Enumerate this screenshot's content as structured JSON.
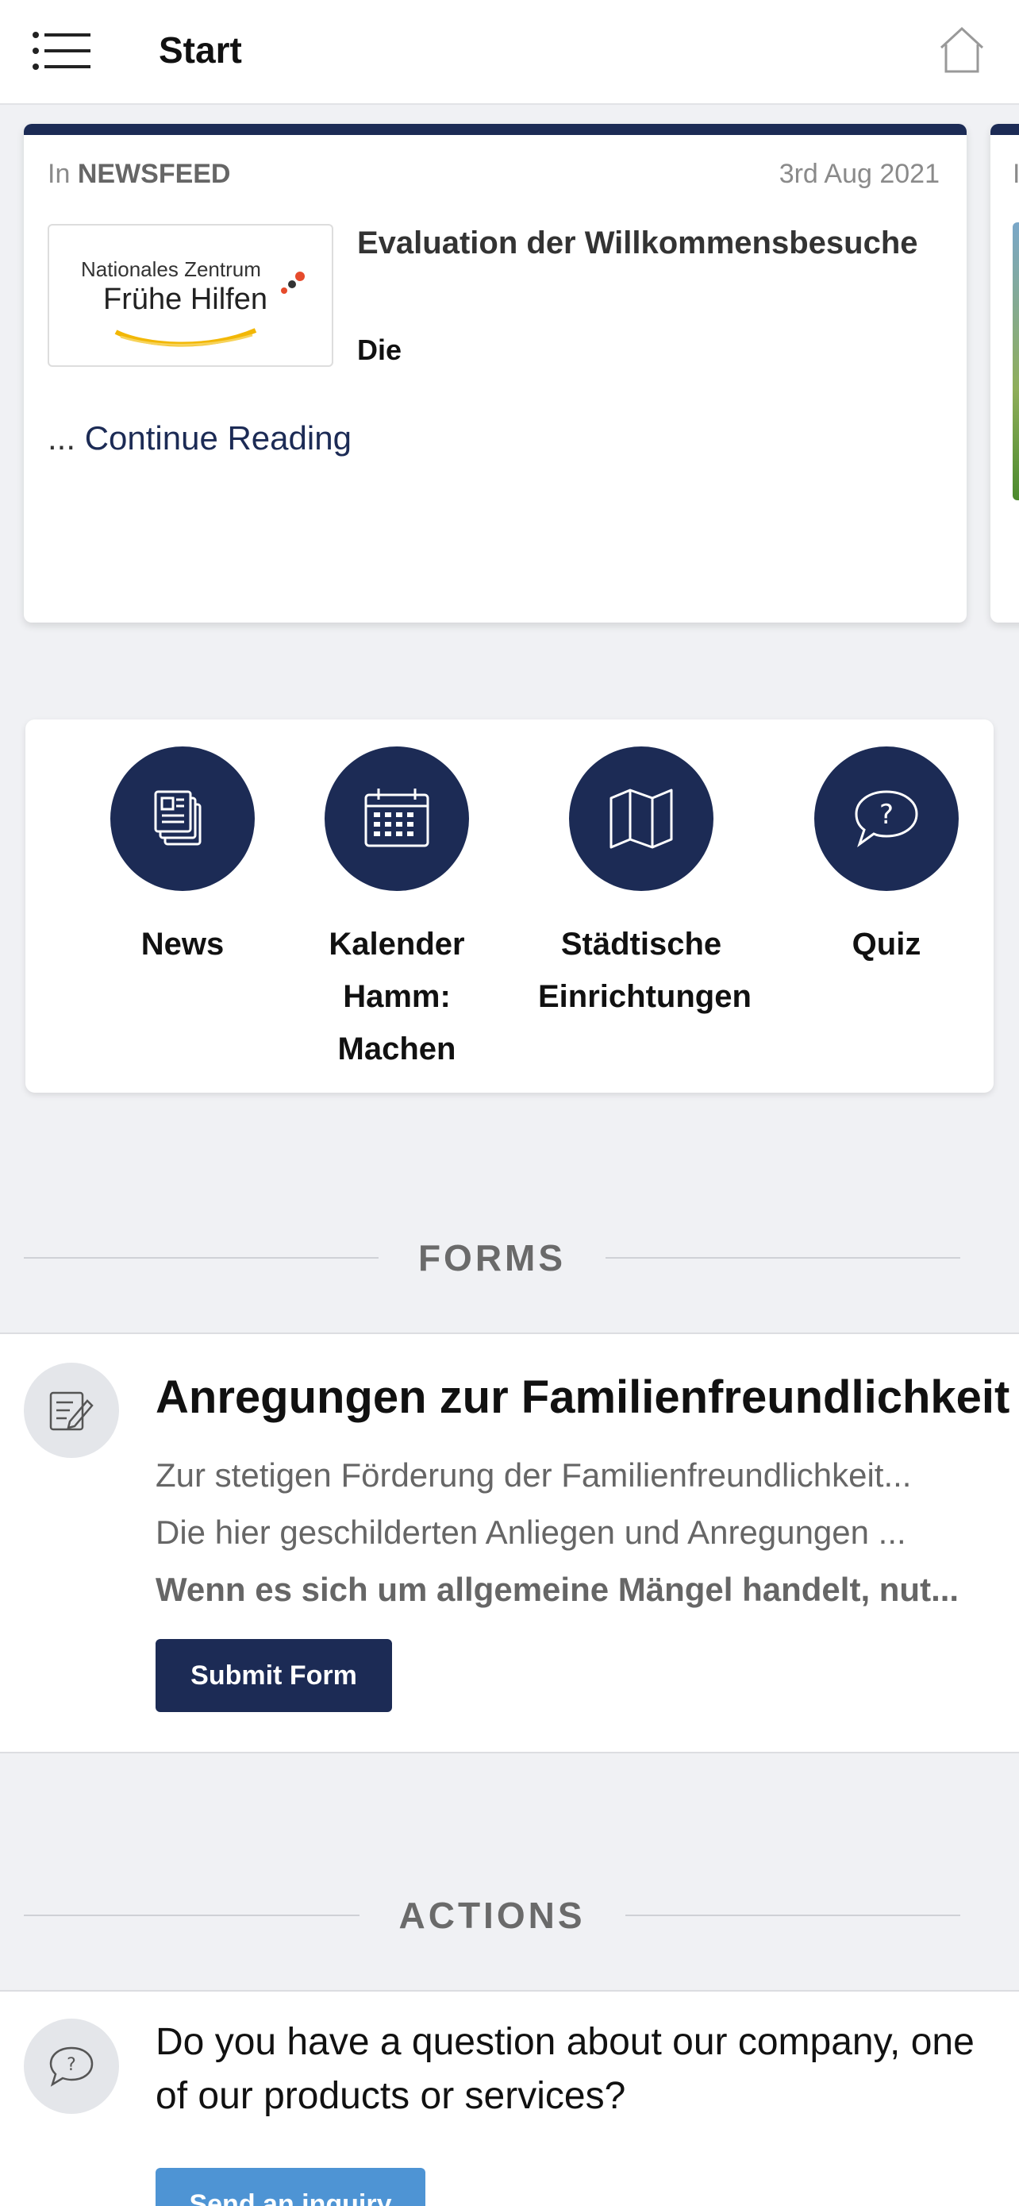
{
  "header": {
    "title": "Start"
  },
  "news_card": {
    "in_prefix": "In",
    "category": "NEWSFEED",
    "date": "3rd Aug 2021",
    "logo_line1": "Nationales Zentrum",
    "logo_line2": "Frühe Hilfen",
    "headline": "Evaluation der Willkommensbesuche",
    "snippet": "Die",
    "continue_dots": "...",
    "continue_label": "Continue Reading"
  },
  "peek_card": {
    "category_initial": "I"
  },
  "shortcuts": [
    {
      "label": "News",
      "icon": "newspaper-icon"
    },
    {
      "label": "Kalender Hamm: Machen",
      "icon": "calendar-icon"
    },
    {
      "label": "Städtische Einrichtungen",
      "icon": "map-icon"
    },
    {
      "label": "Quiz",
      "icon": "question-bubble-icon"
    }
  ],
  "forms": {
    "section_title": "FORMS",
    "item": {
      "icon": "edit-document-icon",
      "title": "Anregungen zur Familienfreundlichkeit",
      "line1": "Zur stetigen Förderung der Familienfreundlichkeit...",
      "line2": "Die hier geschilderten Anliegen und Anregungen ...",
      "line3": "Wenn es sich um allgemeine Mängel handelt, nut...",
      "button": "Submit Form"
    }
  },
  "actions": {
    "section_title": "ACTIONS",
    "item": {
      "icon": "chat-bubble-icon",
      "text": "Do you have a question about our company, one of our products or services?",
      "button": "Send an inquiry"
    }
  },
  "colors": {
    "primary": "#1c2b55",
    "accent": "#4e94d4",
    "background": "#f0f1f4"
  }
}
